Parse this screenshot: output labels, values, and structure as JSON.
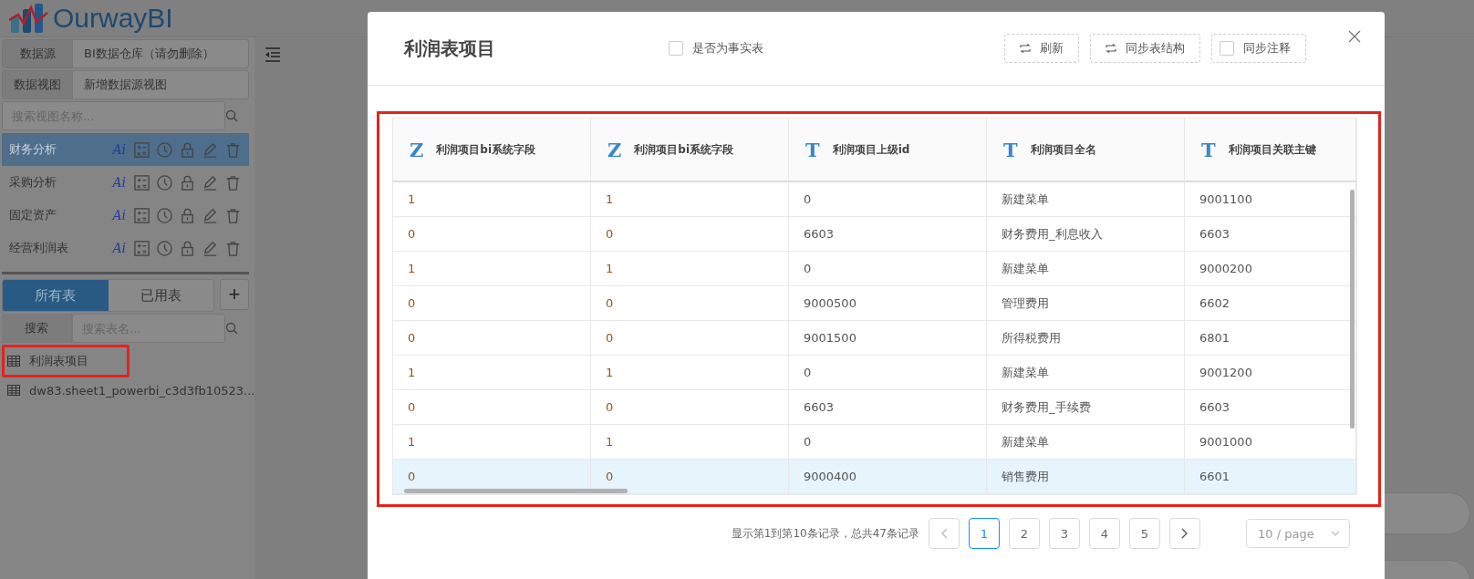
{
  "header": {
    "logo_text": "OurwayBI"
  },
  "sidebar": {
    "datasource": {
      "label": "数据源",
      "value": "BI数据仓库（请勿删除）"
    },
    "view": {
      "label": "数据视图",
      "value": "新增数据源视图"
    },
    "view_search": {
      "placeholder": "搜索视图名称..."
    },
    "views": [
      {
        "name": "财务分析",
        "ai_badge": "Ai",
        "selected": true
      },
      {
        "name": "采购分析",
        "ai_badge": "Ai",
        "selected": false
      },
      {
        "name": "固定资产",
        "ai_badge": "Ai",
        "selected": false
      },
      {
        "name": "经营利润表",
        "ai_badge": "Ai",
        "selected": false
      }
    ],
    "table_tabs": [
      {
        "label": "所有表",
        "selected": true
      },
      {
        "label": "已用表",
        "selected": false
      }
    ],
    "add_button": "+",
    "table_search": {
      "label": "搜索",
      "placeholder": "搜索表名..."
    },
    "tables": [
      {
        "name": "利润表项目",
        "highlighted": true
      },
      {
        "name": "dw83.sheet1_powerbi_c3d3fb10523...",
        "highlighted": false
      }
    ]
  },
  "modal": {
    "title": "利润表项目",
    "fact_table": {
      "label": "是否为事实表",
      "checked": false
    },
    "buttons": [
      {
        "label": "刷新",
        "kind": "refresh"
      },
      {
        "label": "同步表结构",
        "kind": "refresh"
      },
      {
        "label": "同步注释",
        "kind": "checkbox",
        "checked": false
      }
    ],
    "table": {
      "highlighted": true,
      "columns": [
        {
          "label": "利润项目bi系统字段",
          "type_glyph": "Z",
          "kind": "numeric"
        },
        {
          "label": "利润项目bi系统字段",
          "type_glyph": "Z",
          "kind": "numeric"
        },
        {
          "label": "利润项目上级id",
          "type_glyph": "T",
          "kind": "text"
        },
        {
          "label": "利润项目全名",
          "type_glyph": "T",
          "kind": "text"
        },
        {
          "label": "利润项目关联主键",
          "type_glyph": "T",
          "kind": "text"
        }
      ],
      "rows": [
        {
          "cells": [
            "1",
            "1",
            "0",
            "新建菜单",
            "9001100"
          ],
          "selected": false
        },
        {
          "cells": [
            "0",
            "0",
            "6603",
            "财务费用_利息收入",
            "6603"
          ],
          "selected": false
        },
        {
          "cells": [
            "1",
            "1",
            "0",
            "新建菜单",
            "9000200"
          ],
          "selected": false
        },
        {
          "cells": [
            "0",
            "0",
            "9000500",
            "管理费用",
            "6602"
          ],
          "selected": false
        },
        {
          "cells": [
            "0",
            "0",
            "9001500",
            "所得税费用",
            "6801"
          ],
          "selected": false
        },
        {
          "cells": [
            "1",
            "1",
            "0",
            "新建菜单",
            "9001200"
          ],
          "selected": false
        },
        {
          "cells": [
            "0",
            "0",
            "6603",
            "财务费用_手续费",
            "6603"
          ],
          "selected": false
        },
        {
          "cells": [
            "1",
            "1",
            "0",
            "新建菜单",
            "9001000"
          ],
          "selected": false
        },
        {
          "cells": [
            "0",
            "0",
            "9000400",
            "销售费用",
            "6601"
          ],
          "selected": true
        }
      ]
    },
    "pagination": {
      "summary": "显示第1到第10条记录，总共47条记录",
      "pages": [
        {
          "label": "1",
          "selected": true
        },
        {
          "label": "2",
          "selected": false
        },
        {
          "label": "3",
          "selected": false
        },
        {
          "label": "4",
          "selected": false
        },
        {
          "label": "5",
          "selected": false
        }
      ],
      "page_size": "10 / page"
    }
  }
}
